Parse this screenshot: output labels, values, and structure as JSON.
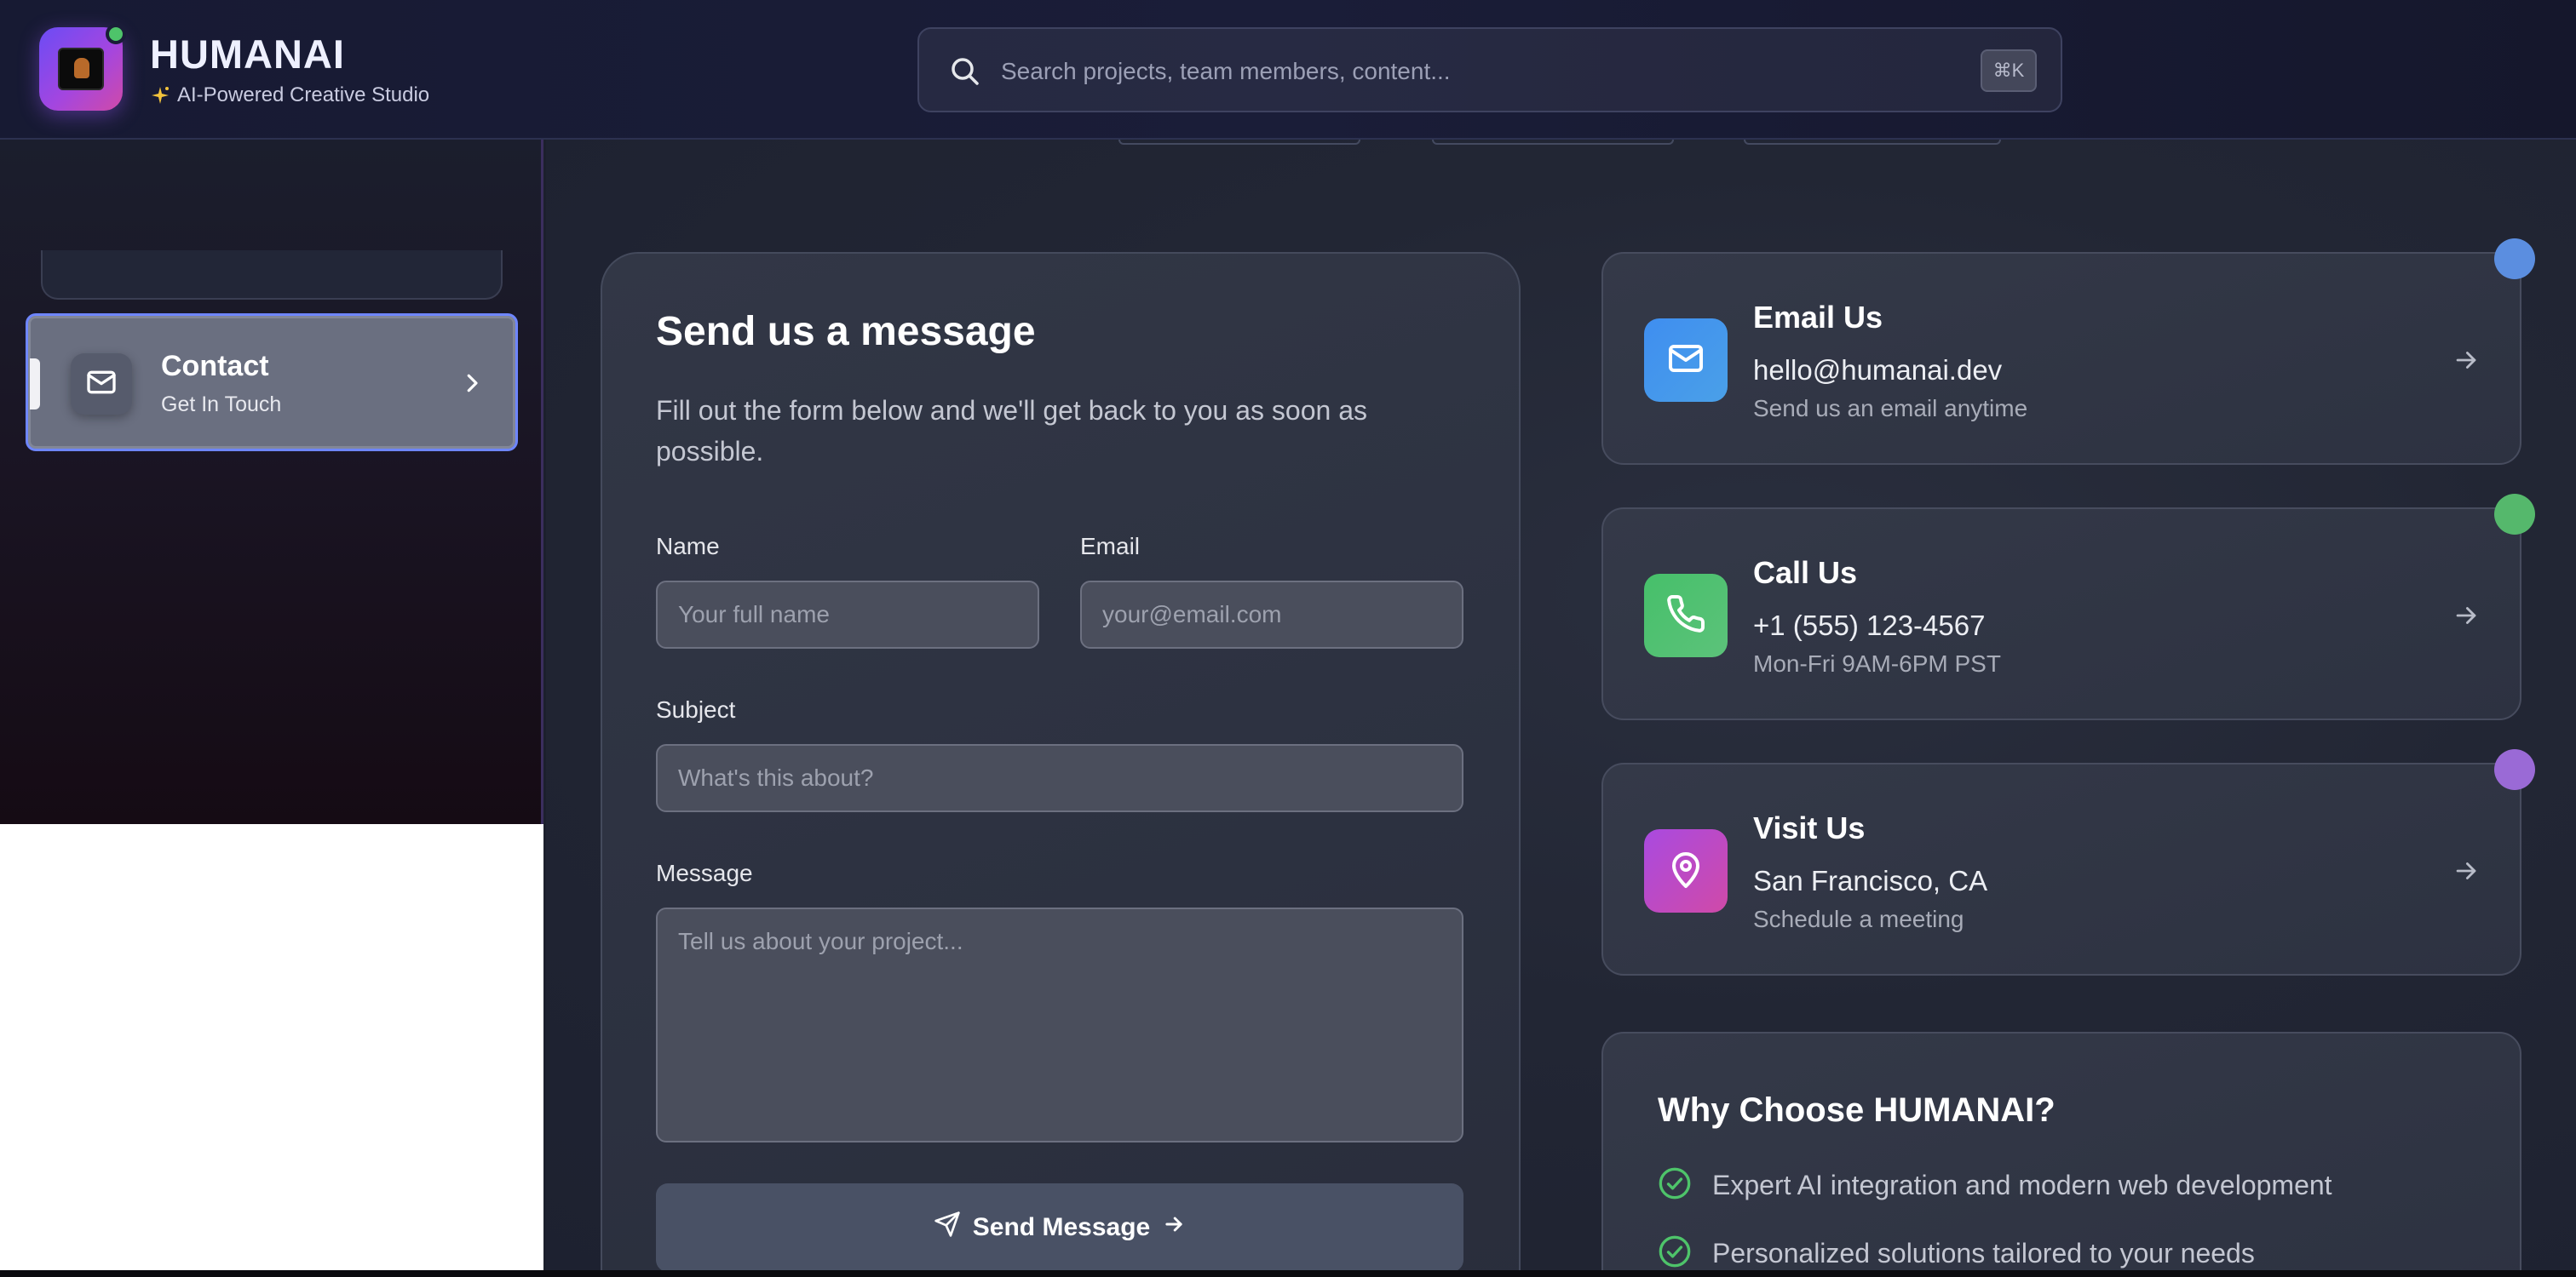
{
  "header": {
    "brand": "HUMANAI",
    "tagline": "AI-Powered Creative Studio",
    "search_placeholder": "Search projects, team members, content...",
    "shortcut": "⌘K"
  },
  "sidebar": {
    "active_item": {
      "title": "Contact",
      "subtitle": "Get In Touch"
    }
  },
  "form": {
    "title": "Send us a message",
    "description": "Fill out the form below and we'll get back to you as soon as possible.",
    "name_label": "Name",
    "name_placeholder": "Your full name",
    "email_label": "Email",
    "email_placeholder": "your@email.com",
    "subject_label": "Subject",
    "subject_placeholder": "What's this about?",
    "message_label": "Message",
    "message_placeholder": "Tell us about your project...",
    "submit_label": "Send Message"
  },
  "contact_cards": [
    {
      "title": "Email Us",
      "value": "hello@humanai.dev",
      "sub": "Send us an email anytime",
      "icon": "mail-icon",
      "color": "#4a8fe8"
    },
    {
      "title": "Call Us",
      "value": "+1 (555) 123-4567",
      "sub": "Mon-Fri 9AM-6PM PST",
      "icon": "phone-icon",
      "color": "#4fbf6a"
    },
    {
      "title": "Visit Us",
      "value": "San Francisco, CA",
      "sub": "Schedule a meeting",
      "icon": "map-pin-icon",
      "color": "#b04ad8"
    }
  ],
  "why": {
    "title": "Why Choose HUMANAI?",
    "items": [
      "Expert AI integration and modern web development",
      "Personalized solutions tailored to your needs"
    ]
  },
  "colors": {
    "accent": "#6e86ff",
    "check": "#4ec46a",
    "brand_gradient_start": "#6b4cf5",
    "brand_gradient_end": "#d04aa8"
  }
}
